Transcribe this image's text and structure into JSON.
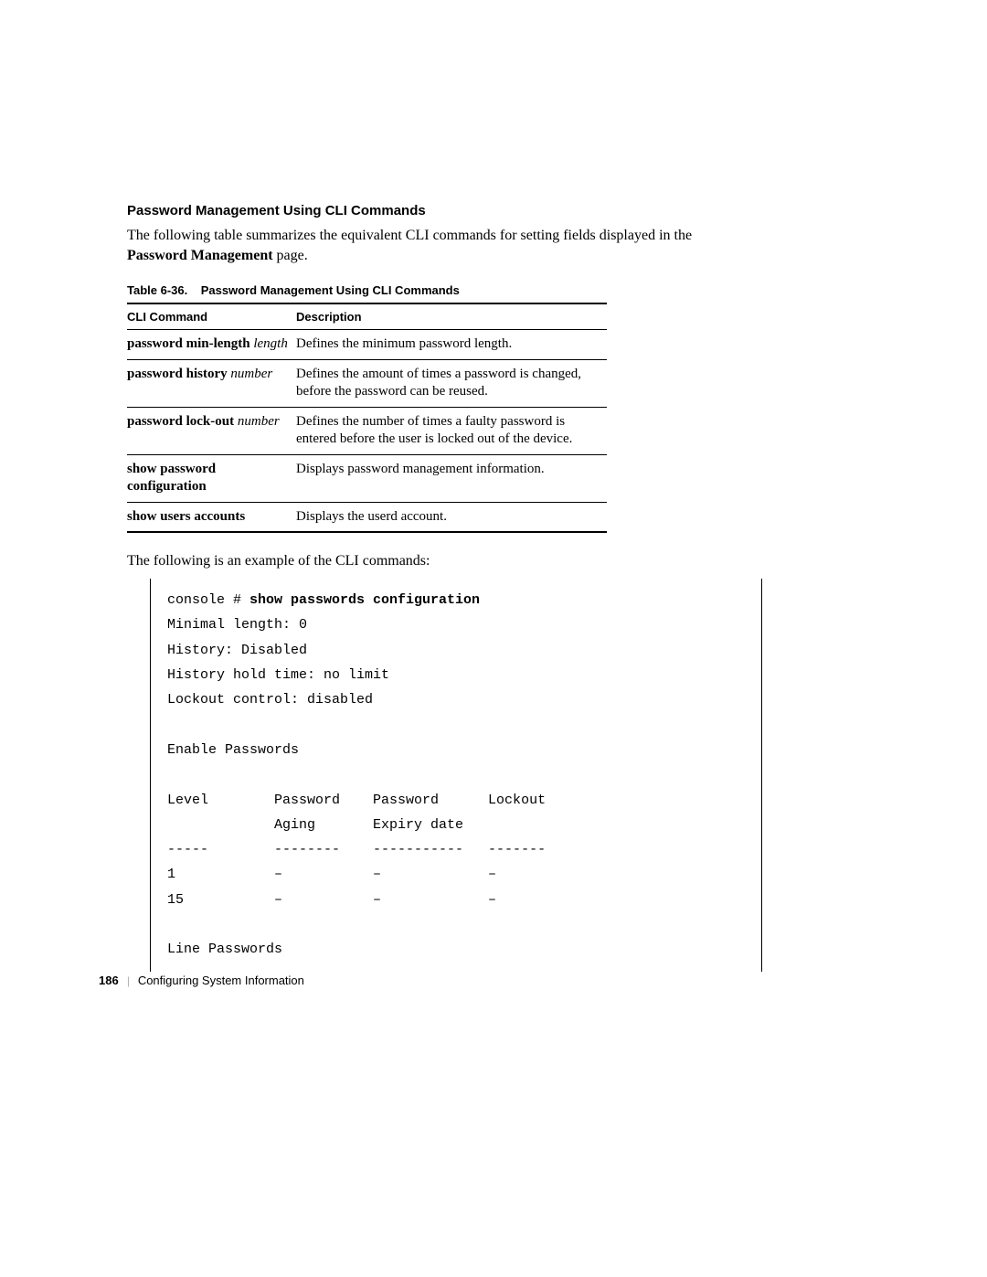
{
  "heading": "Password Management Using CLI Commands",
  "intro": {
    "line1": "The following table summarizes the equivalent CLI commands for setting fields displayed in the",
    "bold_term": "Password Management",
    "line2_suffix": " page."
  },
  "table": {
    "caption_prefix": "Table 6-36.",
    "caption_title": "Password Management Using CLI Commands",
    "headers": {
      "col1": "CLI Command",
      "col2": "Description"
    },
    "rows": [
      {
        "cmd": "password min-length",
        "arg": "length",
        "desc": "Defines the minimum password length."
      },
      {
        "cmd": "password history",
        "arg": "number",
        "desc": "Defines the amount of times a password is changed, before the password can be reused."
      },
      {
        "cmd": "password lock-out",
        "arg": "number",
        "desc": "Defines the number of times a faulty password is entered before the user is locked out of the device."
      },
      {
        "cmd": "show password configuration",
        "arg": "",
        "desc": "Displays password management information."
      },
      {
        "cmd": "show users accounts",
        "arg": "",
        "desc": "Displays the userd account."
      }
    ]
  },
  "example_intro": "The following is an example of the CLI commands:",
  "cli": {
    "prompt": "console # ",
    "command": "show passwords configuration",
    "body": "\nMinimal length: 0\nHistory: Disabled\nHistory hold time: no limit\nLockout control: disabled\n\nEnable Passwords\n\nLevel        Password    Password      Lockout\n             Aging       Expiry date\n-----        --------    -----------   -------\n1            –           –             –\n15           –           –             –\n\nLine Passwords\n"
  },
  "footer": {
    "page_num": "186",
    "section": "Configuring System Information"
  }
}
